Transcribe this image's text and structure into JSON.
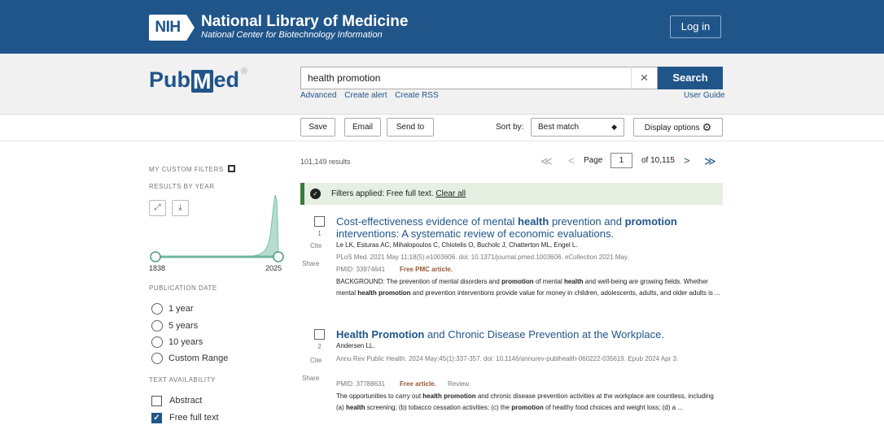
{
  "header": {
    "nih_badge": "NIH",
    "title": "National Library of Medicine",
    "subtitle": "National Center for Biotechnology Information",
    "login_label": "Log in"
  },
  "search": {
    "logo_left": "Pub",
    "logo_m": "M",
    "logo_right": "ed",
    "logo_reg": "®",
    "query": "health promotion",
    "clear_label": "×",
    "button_label": "Search",
    "links": [
      "Advanced",
      "Create alert",
      "Create RSS"
    ],
    "user_guide": "User Guide"
  },
  "toolbar": {
    "save": "Save",
    "email": "Email",
    "send_to": "Send to",
    "sort_label": "Sort by:",
    "sort_value": "Best match",
    "sort_caret": "◆",
    "display_options": "Display options",
    "gear": "⚙"
  },
  "sidebar": {
    "custom_filters": "MY CUSTOM FILTERS",
    "results_by_year": "RESULTS BY YEAR",
    "expand_icon": "⤢",
    "download_icon": "⤓",
    "year_start": "1838",
    "year_end": "2025",
    "publication_date": "PUBLICATION DATE",
    "date_options": [
      "1 year",
      "5 years",
      "10 years",
      "Custom Range"
    ],
    "text_availability": "TEXT AVAILABILITY",
    "text_options": [
      {
        "label": "Abstract",
        "checked": false
      },
      {
        "label": "Free full text",
        "checked": true
      }
    ],
    "check_mark": "✓"
  },
  "results": {
    "count": "101,149 results",
    "first": "≪",
    "prev": "<",
    "page_label": "Page",
    "page_value": "1",
    "of_label": "of 10,115",
    "next": ">",
    "last": "≫"
  },
  "filter_banner": {
    "text": "Filters applied: Free full text.",
    "clear": "Clear all",
    "icon": "✓"
  },
  "articles": [
    {
      "num": "1",
      "title_parts": [
        "Cost-effectiveness evidence of mental ",
        "health",
        " prevention and ",
        "promotion",
        " interventions: A systematic review of economic evaluations."
      ],
      "authors": "Le LK, Esturas AC, Mihalopoulos C, Chiotelis O, Bucholc J, Chatterton ML, Engel L.",
      "journal": "PLoS Med. 2021 May 11;18(5):e1003606. doi: 10.1371/journal.pmed.1003606. eCollection 2021 May.",
      "pmid": "PMID: 33974641",
      "free": "Free PMC article.",
      "review": "",
      "snippet_parts": [
        "BACKGROUND: The prevention of mental disorders and ",
        "promotion",
        " of mental ",
        "health",
        " and well-being are growing fields. Whether mental ",
        "health promotion",
        " and prevention interventions provide value for money in children, adolescents, adults, and older adults is ..."
      ]
    },
    {
      "num": "2",
      "title_parts": [
        "Health Promotion",
        " and Chronic Disease Prevention at the Workplace."
      ],
      "authors": "Andersen LL.",
      "journal": "Annu Rev Public Health. 2024 May;45(1):337-357. doi: 10.1146/annurev-publhealth-060222-035619. Epub 2024 Apr 3.",
      "pmid": "PMID: 37788631",
      "free": "Free article.",
      "review": "Review.",
      "snippet_parts": [
        "The opportunities to carry out ",
        "health promotion",
        " and chronic disease prevention activities at the workplace are countless, including (a) ",
        "health",
        " screening; (b) tobacco cessation activities; (c) the ",
        "promotion",
        " of healthy food choices and weight loss; (d) a ..."
      ]
    }
  ],
  "article_actions": {
    "cite": "Cite",
    "share": "Share"
  }
}
